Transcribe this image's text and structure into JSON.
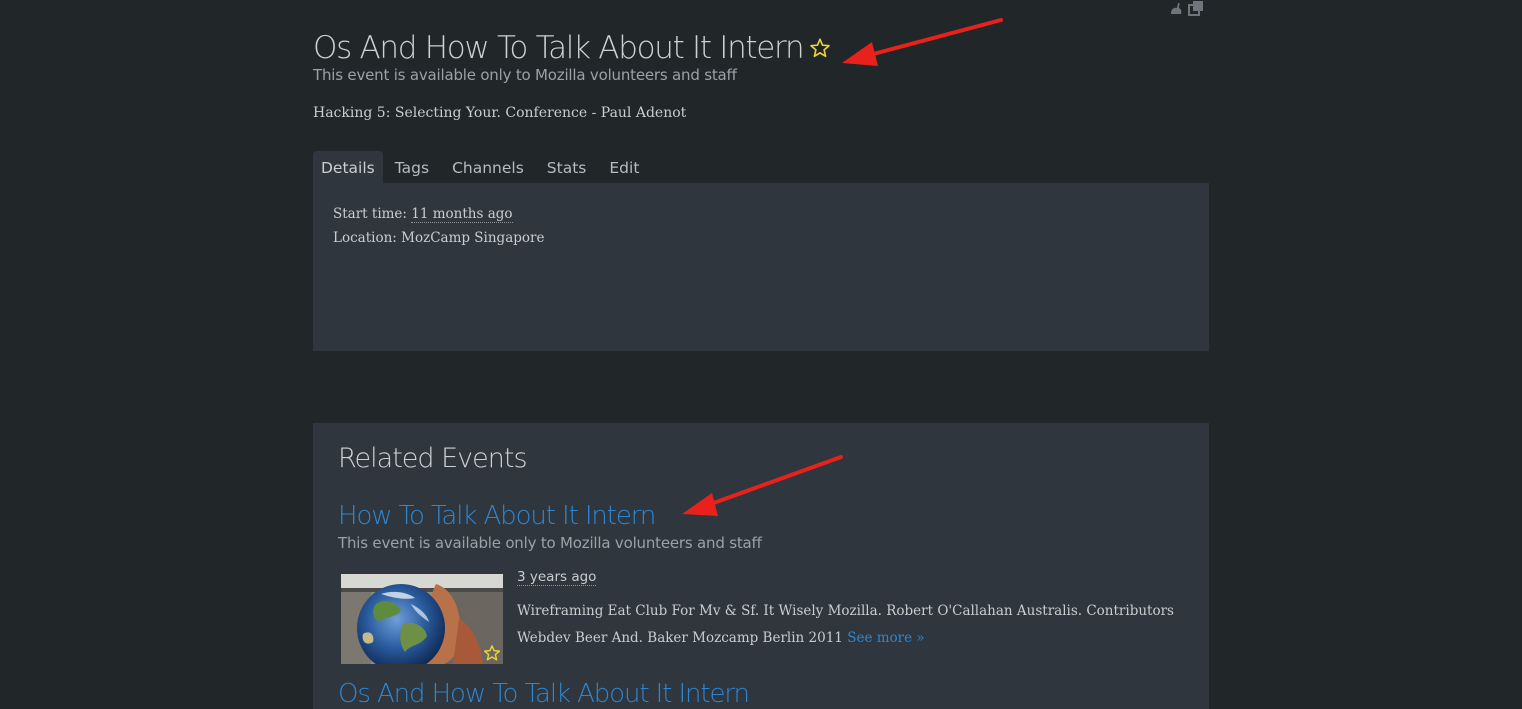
{
  "event": {
    "title": "Os And How To Talk About It Intern",
    "access_note": "This event is available only to Mozilla volunteers and staff",
    "short_description": "Hacking 5: Selecting Your. Conference - Paul Adenot"
  },
  "tabs": [
    {
      "label": "Details",
      "active": true
    },
    {
      "label": "Tags",
      "active": false
    },
    {
      "label": "Channels",
      "active": false
    },
    {
      "label": "Stats",
      "active": false
    },
    {
      "label": "Edit",
      "active": false
    }
  ],
  "details": {
    "start_time_label": "Start time:",
    "start_time_value": "11 months ago",
    "location_label": "Location:",
    "location_value": "MozCamp Singapore"
  },
  "related": {
    "heading": "Related Events",
    "events": [
      {
        "title": "How To Talk About It Intern",
        "access_note": "This event is available only to Mozilla volunteers and staff",
        "time_ago": "3 years ago",
        "description": "Wireframing Eat Club For Mv & Sf. It Wisely Mozilla. Robert O'Callahan Australis. Contributors Webdev Beer And. Baker Mozcamp Berlin 2011",
        "see_more": "See more »"
      },
      {
        "title": "Os And How To Talk About It Intern"
      }
    ]
  },
  "colors": {
    "background": "#212629",
    "panel": "#2f363d",
    "link": "#2e86d2",
    "star": "#e8d23a",
    "annotation_arrow": "#e8211c"
  },
  "icons": [
    "star-icon",
    "rabbit-icon",
    "popout-icon"
  ]
}
